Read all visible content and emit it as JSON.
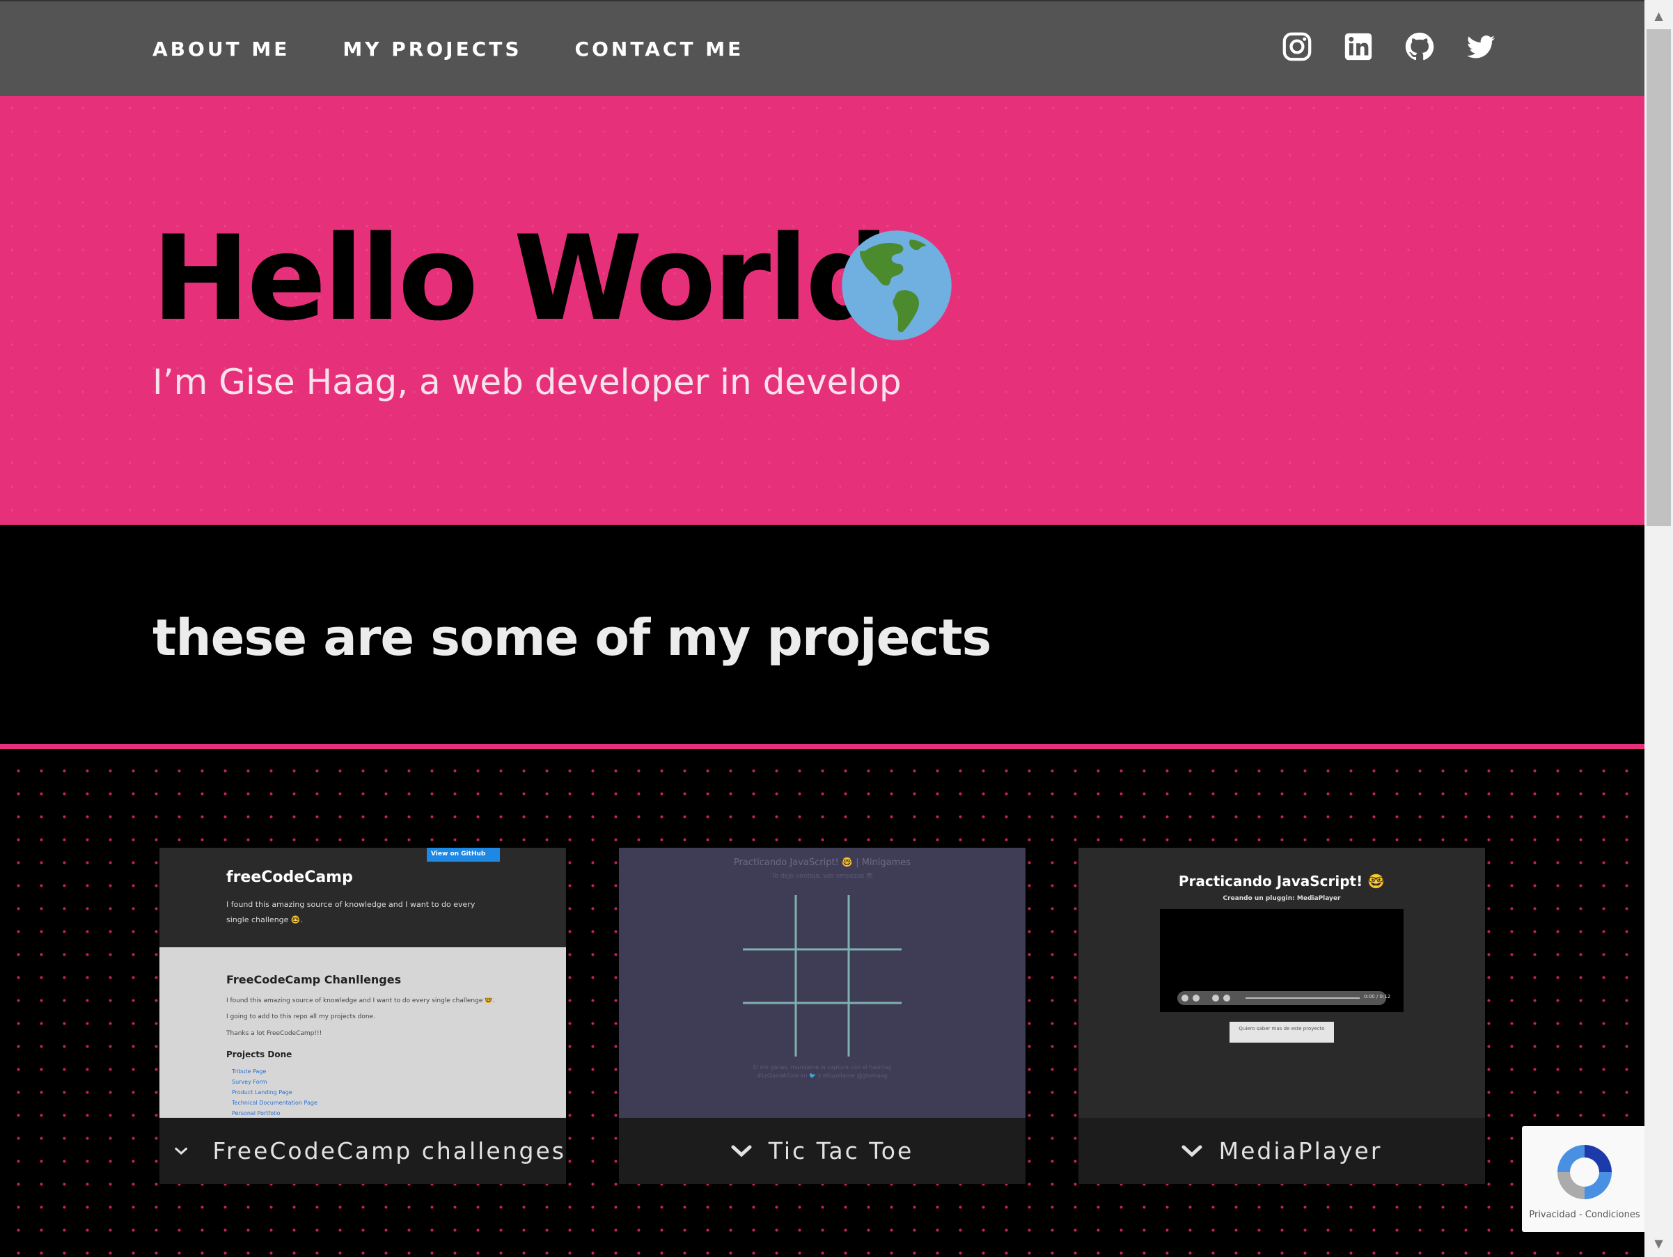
{
  "nav": {
    "links": [
      "ABOUT ME",
      "MY PROJECTS",
      "CONTACT ME"
    ],
    "social": [
      "instagram-icon",
      "linkedin-icon",
      "github-icon",
      "twitter-icon"
    ]
  },
  "hero": {
    "title": "Hello World",
    "subtitle": "I’m Gise Haag, a web developer in develop",
    "icon": "globe-americas-icon"
  },
  "projects": {
    "heading": "these are some of my projects",
    "cards": [
      {
        "label": "FreeCodeCamp challenges",
        "thumb": {
          "badge": "View on GitHub",
          "name": "freeCodeCamp",
          "desc": "I found this amazing source of knowledge and I want to do every single challenge 🤓.",
          "heading": "FreeCodeCamp Chanllenges",
          "p1": "I found this amazing source of knowledge and I want to do every single challenge 🤓.",
          "p2": "I going to add to this repo all my projects done.",
          "p3": "Thanks a lot FreeCodeCamp!!!",
          "list_heading": "Projects Done",
          "list": [
            "Tribute Page",
            "Survey Form",
            "Product Landing Page",
            "Technical Documentation Page",
            "Personal Portfolio"
          ]
        }
      },
      {
        "label": "Tic Tac Toe",
        "thumb": {
          "title": "Practicando JavaScript! 🤓 | Minigames",
          "sub": "Te dejo ventaja, vos empezas 😎",
          "foot1": "Si me ganas, mandame la captura con el hashtag",
          "foot2": "#LeGaneAGise en 🐦 y etiquetame @gisehaag"
        }
      },
      {
        "label": "MediaPlayer",
        "thumb": {
          "title": "Practicando JavaScript! 🤓",
          "sub": "Creando un pluggin: MediaPlayer",
          "time": "0:00 / 0:12",
          "button": "Quiero saber mas de este proyecto"
        }
      }
    ]
  },
  "recaptcha": {
    "text": "Privacidad - Condiciones"
  },
  "colors": {
    "nav": "#545454",
    "hero": "#e6317a",
    "accent": "#e6317a",
    "card": "#262626"
  }
}
